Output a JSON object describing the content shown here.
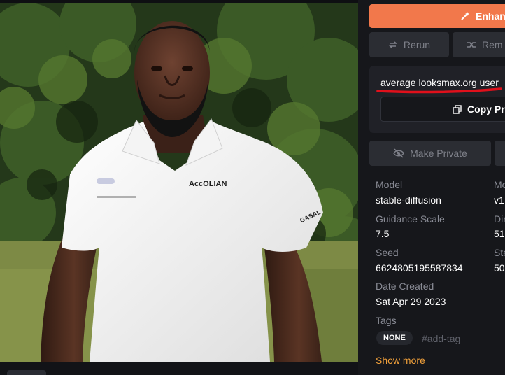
{
  "actions": {
    "enhance_label": "Enhan",
    "rerun_label": "Rerun",
    "remix_label": "Rem",
    "make_private_label": "Make Private",
    "copy_prompt_label": "Copy Pr"
  },
  "prompt": {
    "text": "average looksmax.org user"
  },
  "image": {
    "shirt_logo_text": "AccOLIAN",
    "shirt_sleeve_text": "GASAL"
  },
  "details": {
    "model_label": "Model",
    "model_value": "stable-diffusion",
    "model2_label": "Mo",
    "model2_value": "v1.",
    "guidance_label": "Guidance Scale",
    "guidance_value": "7.5",
    "dims_label": "Dir",
    "dims_value": "51",
    "seed_label": "Seed",
    "seed_value": "6624805195587834",
    "steps_label": "Ste",
    "steps_value": "50",
    "date_label": "Date Created",
    "date_value": "Sat Apr 29 2023",
    "tags_label": "Tags",
    "tag_none": "NONE",
    "add_tag": "#add-tag",
    "show_more": "Show more"
  },
  "colors": {
    "accent": "#f2784b",
    "link": "#f2a13b",
    "annotation": "#e0101b"
  }
}
